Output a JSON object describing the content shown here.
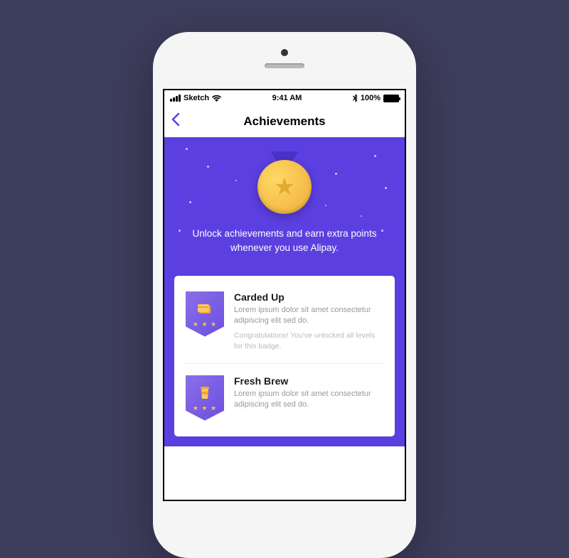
{
  "status": {
    "carrier": "Sketch",
    "time": "9:41 AM",
    "battery": "100%"
  },
  "nav": {
    "title": "Achievements"
  },
  "hero": {
    "text": "Unlock achievements and earn extra points whenever you use Alipay."
  },
  "achievements": [
    {
      "title": "Carded Up",
      "description": "Lorem ipsum dolor sit amet consectetur adipiscing elit sed do.",
      "congrats": "Congratulations! You've unlocked all levels for this badge.",
      "icon": "card"
    },
    {
      "title": "Fresh Brew",
      "description": "Lorem ipsum dolor sit amet consectetur adipiscing elit sed do.",
      "congrats": "",
      "icon": "coffee"
    }
  ]
}
